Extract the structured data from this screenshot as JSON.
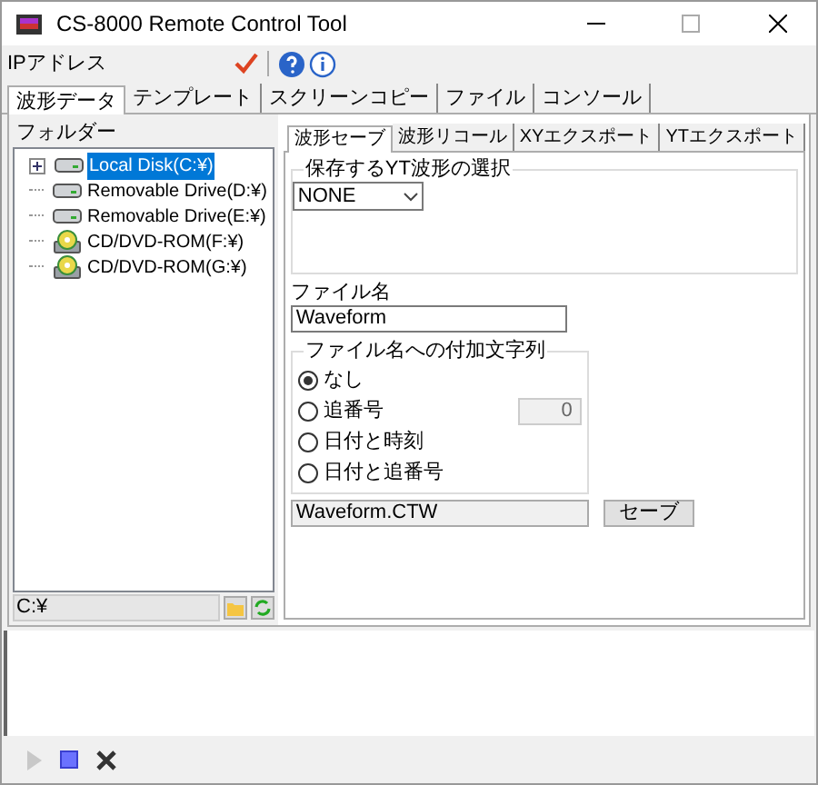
{
  "window": {
    "title": "CS-8000 Remote Control Tool"
  },
  "address_bar": {
    "label": "IPアドレス"
  },
  "tabs": [
    {
      "label": "波形データ",
      "selected": true
    },
    {
      "label": "テンプレート",
      "selected": false
    },
    {
      "label": "スクリーンコピー",
      "selected": false
    },
    {
      "label": "ファイル",
      "selected": false
    },
    {
      "label": "コンソール",
      "selected": false
    }
  ],
  "folder_panel": {
    "label": "フォルダー",
    "path": "C:¥",
    "drives": [
      {
        "label": "Local Disk(C:¥)",
        "kind": "disk",
        "selected": true,
        "expanded": false
      },
      {
        "label": "Removable Drive(D:¥)",
        "kind": "disk",
        "selected": false
      },
      {
        "label": "Removable Drive(E:¥)",
        "kind": "disk",
        "selected": false
      },
      {
        "label": "CD/DVD-ROM(F:¥)",
        "kind": "cd",
        "selected": false
      },
      {
        "label": "CD/DVD-ROM(G:¥)",
        "kind": "cd",
        "selected": false
      }
    ]
  },
  "sub_tabs": [
    {
      "label": "波形セーブ",
      "selected": true
    },
    {
      "label": "波形リコール",
      "selected": false
    },
    {
      "label": "XYエクスポート",
      "selected": false
    },
    {
      "label": "YTエクスポート",
      "selected": false
    }
  ],
  "save_panel": {
    "waveform_group": "保存するYT波形の選択",
    "waveform_select": "NONE",
    "filename_label": "ファイル名",
    "filename": "Waveform",
    "suffix_group": "ファイル名への付加文字列",
    "suffix_options": [
      {
        "label": "なし",
        "selected": true
      },
      {
        "label": "追番号",
        "selected": false
      },
      {
        "label": "日付と時刻",
        "selected": false
      },
      {
        "label": "日付と追番号",
        "selected": false
      }
    ],
    "counter": "0",
    "output_name": "Waveform.CTW",
    "save_button": "セーブ"
  },
  "run_toolbar": {
    "play_disabled": true
  }
}
